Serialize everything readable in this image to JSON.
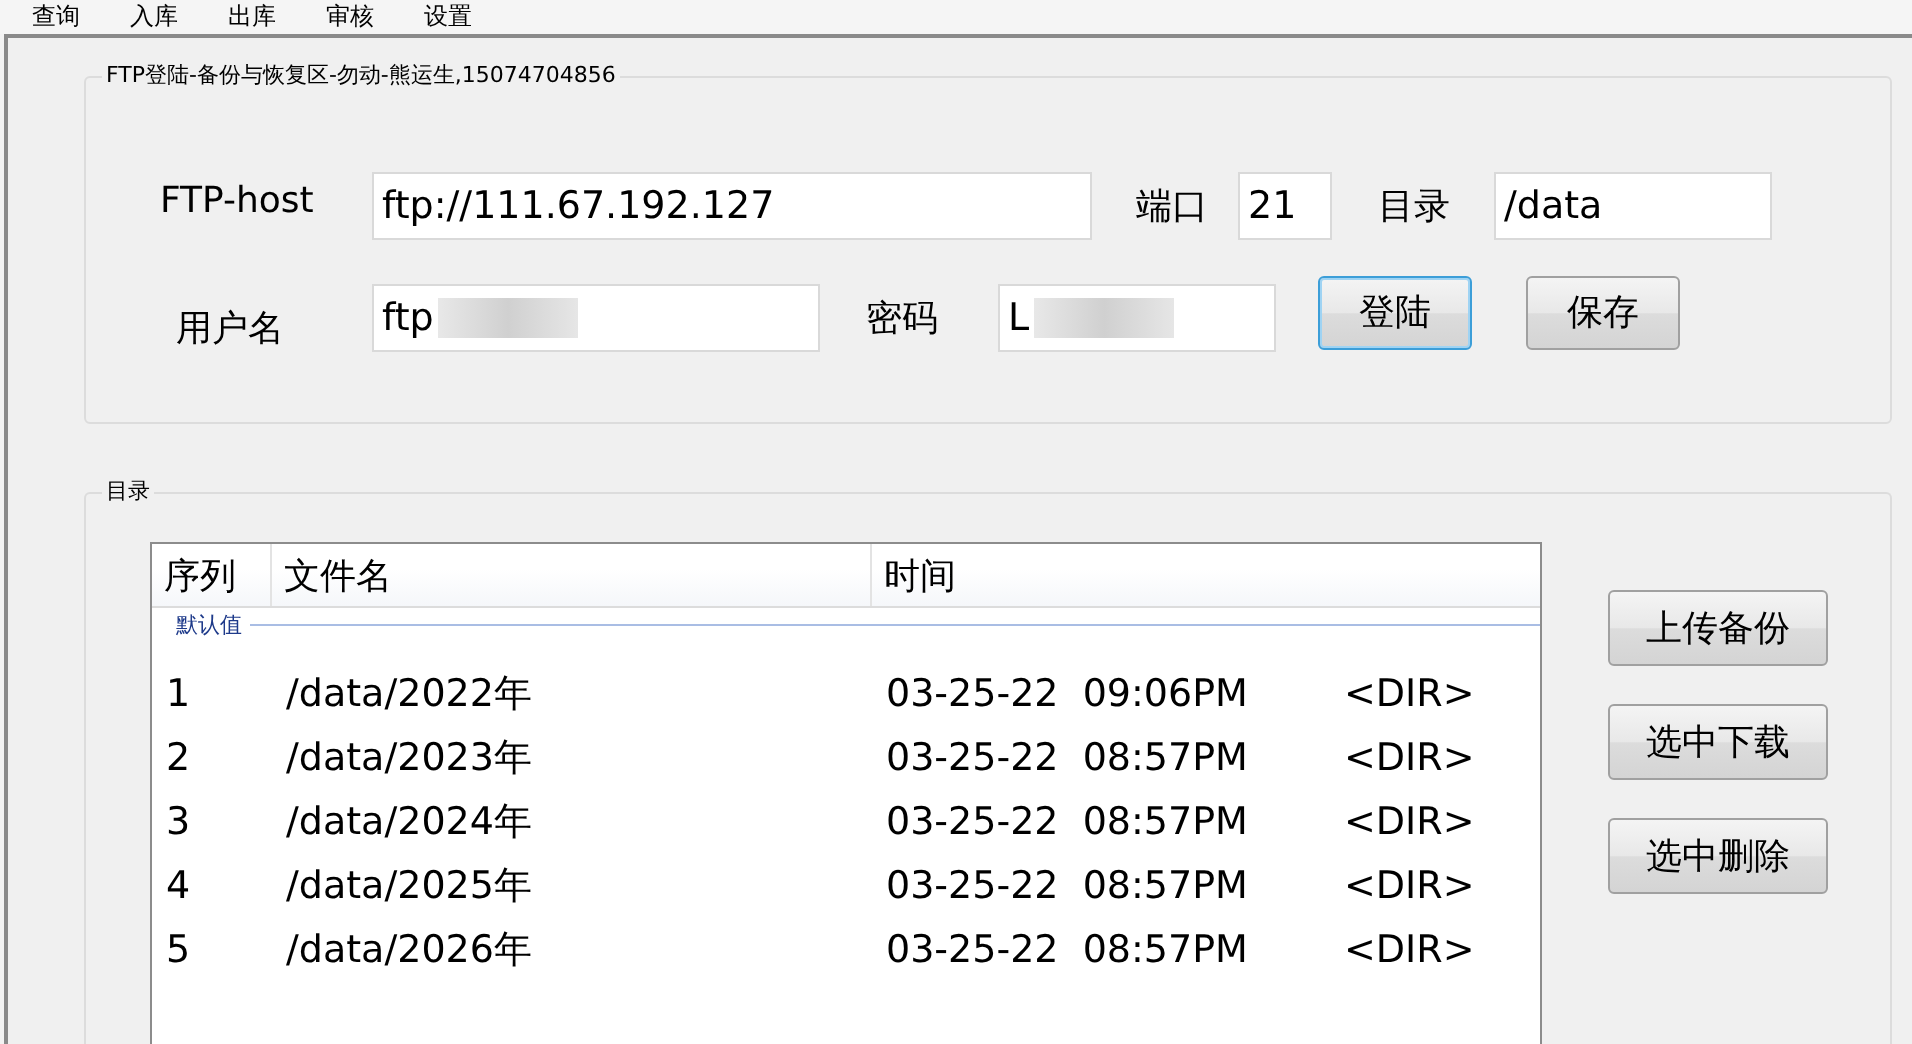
{
  "menu": [
    "查询",
    "入库",
    "出库",
    "审核",
    "设置"
  ],
  "login_group": {
    "title": "FTP登陆-备份与恢复区-勿动-熊运生,15074704856",
    "host_label": "FTP-host",
    "host": "ftp://111.67.192.127",
    "port_label": "端口",
    "port": "21",
    "dir_label": "目录",
    "dir": "/data",
    "user_label": "用户名",
    "user": "ftp",
    "password_label": "密码",
    "password": "L",
    "buttons": [
      {
        "label": "登陆",
        "focused": true
      },
      {
        "label": "保存",
        "focused": false
      }
    ]
  },
  "directory_group": {
    "title": "目录",
    "table": {
      "columns": [
        "序列",
        "文件名",
        "时间"
      ],
      "group": "默认值",
      "rows": [
        {
          "index": "1",
          "name": "/data/2022年",
          "time": "03-25-22  09:06PM",
          "type": "<DIR>"
        },
        {
          "index": "2",
          "name": "/data/2023年",
          "time": "03-25-22  08:57PM",
          "type": "<DIR>"
        },
        {
          "index": "3",
          "name": "/data/2024年",
          "time": "03-25-22  08:57PM",
          "type": "<DIR>"
        },
        {
          "index": "4",
          "name": "/data/2025年",
          "time": "03-25-22  08:57PM",
          "type": "<DIR>"
        },
        {
          "index": "5",
          "name": "/data/2026年",
          "time": "03-25-22  08:57PM",
          "type": "<DIR>"
        }
      ]
    },
    "buttons": [
      "上传备份",
      "选中下载",
      "选中删除"
    ]
  }
}
